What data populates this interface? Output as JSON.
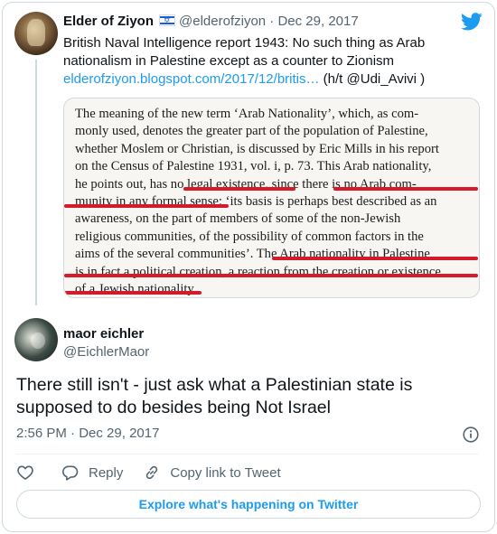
{
  "parent_tweet": {
    "author_name": "Elder of Ziyon",
    "flag_icon": "israel-flag-icon",
    "handle": "@elderofziyon",
    "separator": "·",
    "date": "Dec 29, 2017",
    "text": "British Naval Intelligence report 1943: No such thing as Arab nationalism in Palestine except as a counter to Zionism",
    "link": "elderofziyon.blogspot.com/2017/12/britis…",
    "link_suffix": " (h/t @Udi_Avivi )",
    "scan_lines": [
      "The meaning of the new term ‘Arab Nationality’, which, as com-",
      "monly used, denotes the greater part of the population of Palestine,",
      "whether Moslem or Christian, is discussed by Eric Mills in his report",
      "on the Census of Palestine 1931, vol. i, p. 73.  This Arab nationality,",
      "he points out, has no legal existence, since there is no Arab com-",
      "munity in any formal sense: ‘its basis is perhaps best described as an",
      "awareness, on the part of members of some of the non-Jewish",
      "religious communities, of the possibility of common factors in the",
      "aims of the several communities’.  The Arab nationality in Palestine",
      "is in fact a political creation, a reaction from the creation or existence",
      "of a Jewish nationality."
    ],
    "highlight_color": "#d51a2a"
  },
  "reply_tweet": {
    "author_name": "maor eichler",
    "handle": "@EichlerMaor",
    "text": "There still isn't - just ask what a Palestinian state is supposed to do besides being Not Israel",
    "time": "2:56 PM",
    "separator": "·",
    "date": "Dec 29, 2017"
  },
  "actions": {
    "like_icon": "heart-icon",
    "reply_label": "Reply",
    "copy_label": "Copy link to Tweet"
  },
  "explore_label": "Explore what's happening on Twitter",
  "colors": {
    "accent": "#1d9bf0",
    "muted_text": "#536471",
    "border": "#cfd9de"
  }
}
